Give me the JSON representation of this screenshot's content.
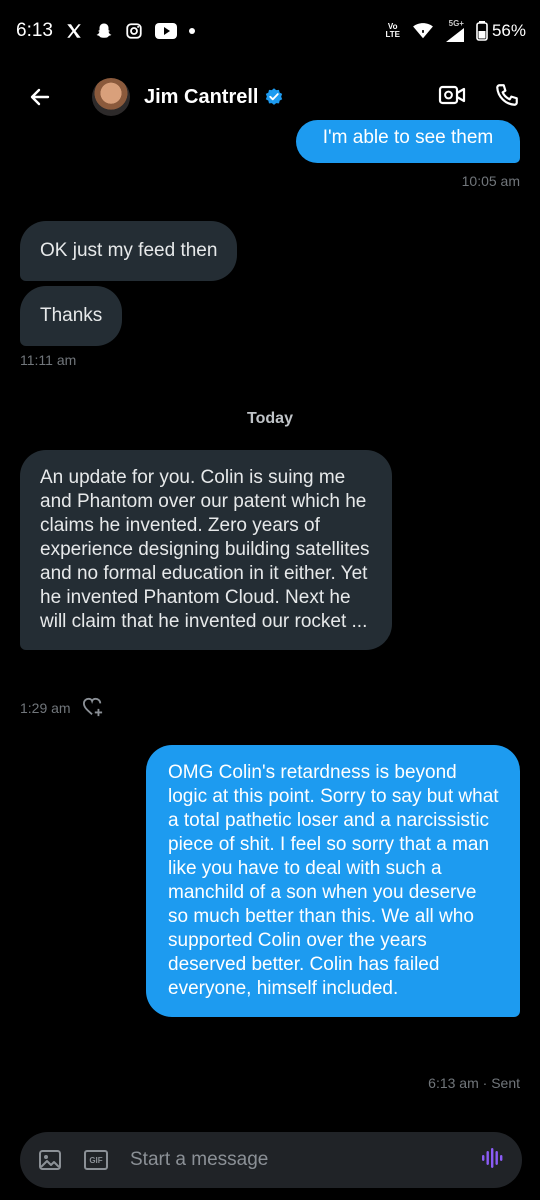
{
  "status_bar": {
    "time": "6:13",
    "network_top": "5G+",
    "volte_top": "Vo",
    "volte_bottom": "LTE",
    "battery": "56%"
  },
  "header": {
    "name": "Jim Cantrell",
    "verified_color": "#1d9bf0"
  },
  "messages": [
    {
      "dir": "out",
      "text": "I'm able to see them",
      "meta": "10:05 am"
    },
    {
      "dir": "in",
      "text": "OK just my feed then"
    },
    {
      "dir": "in",
      "text": "Thanks",
      "meta": "11:11 am"
    },
    {
      "dir": "separator",
      "text": "Today"
    },
    {
      "dir": "in",
      "text": "An update for you.  Colin is suing me and Phantom over our patent which he claims he invented.  Zero years of experience designing building satellites and no formal education in it either.  Yet he invented Phantom Cloud.  Next he will claim that he invented our rocket ...",
      "meta": "1:29 am"
    },
    {
      "dir": "out",
      "text": "OMG Colin's retardness is beyond logic at this point. Sorry to say but what a total pathetic loser and a narcissistic piece of shit. I feel so sorry that a man like you have to deal with such a manchild of a son when you deserve so much better than this. We all who supported Colin over the years deserved better. Colin has failed everyone, himself included.",
      "meta": "6:13 am · Sent"
    }
  ],
  "composer": {
    "gif_label": "GIF",
    "placeholder": "Start a message"
  },
  "colors": {
    "background": "#000000",
    "incoming_bubble": "#242d34",
    "outgoing_bubble": "#1d9bf0",
    "accent": "#1d9bf0",
    "voice_icon": "#8b5cf6"
  }
}
